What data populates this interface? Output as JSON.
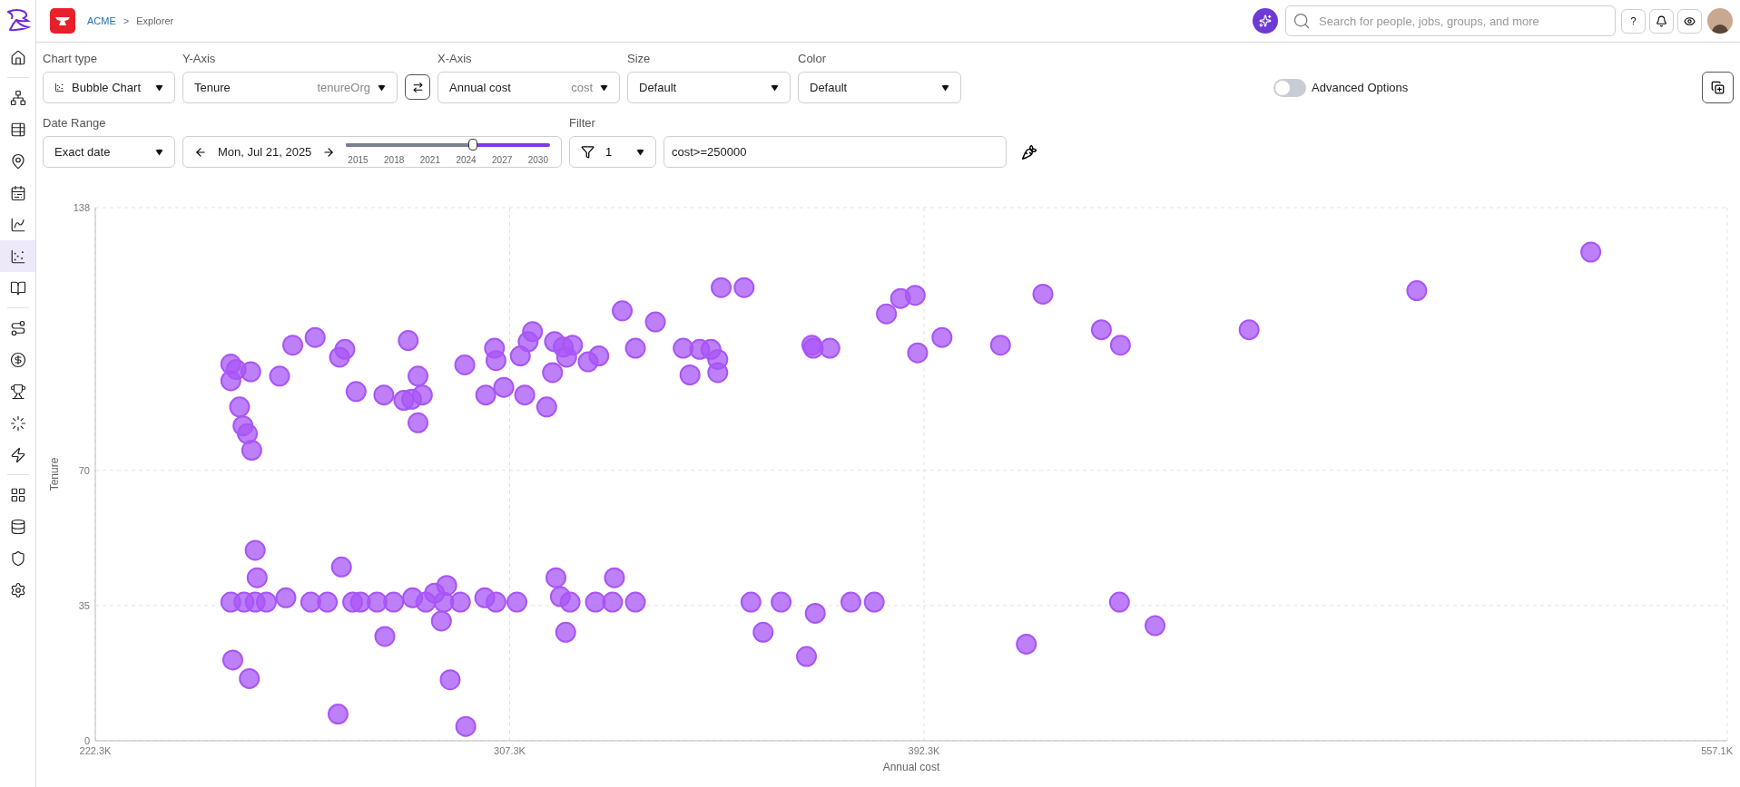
{
  "breadcrumb": [
    {
      "label": "ACME",
      "kind": "link"
    },
    {
      "label": ">",
      "kind": "separator"
    },
    {
      "label": "Explorer",
      "kind": "current"
    }
  ],
  "search": {
    "placeholder": "Search for people, jobs, groups, and more"
  },
  "help_button": "?",
  "sidebar": {
    "items": [
      {
        "selected": false
      },
      {
        "selected": false
      },
      {
        "selected": false
      },
      {
        "selected": false
      },
      {
        "selected": false
      },
      {
        "selected": false
      },
      {
        "selected": true
      },
      {
        "selected": false
      },
      {
        "selected": false
      },
      {
        "selected": false
      },
      {
        "selected": false
      },
      {
        "selected": false
      },
      {
        "selected": false
      },
      {
        "selected": false
      },
      {
        "selected": false
      },
      {
        "selected": false
      },
      {
        "selected": false
      }
    ]
  },
  "controls": {
    "chart_type": {
      "label": "Chart type",
      "value": "Bubble Chart"
    },
    "y_axis": {
      "label": "Y-Axis",
      "value": "Tenure",
      "hint": "tenureOrg"
    },
    "x_axis": {
      "label": "X-Axis",
      "value": "Annual cost",
      "hint": "cost"
    },
    "size": {
      "label": "Size",
      "value": "Default"
    },
    "color": {
      "label": "Color",
      "value": "Default"
    },
    "advanced_options": {
      "label": "Advanced Options",
      "on": false
    },
    "date_range": {
      "label": "Date Range",
      "value": "Exact date"
    },
    "date": {
      "value": "Mon, Jul 21, 2025",
      "level": 0.62,
      "ticks": [
        "2015",
        "2018",
        "2021",
        "2024",
        "2027",
        "2030"
      ]
    },
    "filter": {
      "label": "Filter",
      "count": "1",
      "expression": "cost>=250000"
    }
  },
  "chart": {
    "chart_data": {
      "type": "scatter",
      "grid": true,
      "xlabel": "Annual cost",
      "ylabel": "Tenure",
      "xlim": [
        222.3,
        557.1
      ],
      "ylim": [
        0,
        138
      ],
      "xticks": [
        {
          "value": 222.3,
          "label": "222.3K"
        },
        {
          "value": 307.3,
          "label": "307.3K"
        },
        {
          "value": 392.3,
          "label": "392.3K"
        },
        {
          "value": 557.1,
          "label": "557.1K"
        }
      ],
      "yticks": [
        0,
        35,
        70,
        138
      ],
      "x": [
        250.1,
        251.2,
        254.2,
        250.1,
        260.1,
        262.8,
        267.4,
        273.5,
        272.4,
        275.8,
        281.5,
        286.5,
        288.5,
        285.6,
        287.2,
        289.4,
        288.5,
        251.9,
        252.6,
        253.5,
        254.4,
        298.1,
        304.2,
        304.5,
        302.4,
        306.1,
        310.4,
        309.5,
        312.0,
        311.1,
        316.5,
        318.3,
        320.2,
        319.0,
        316.1,
        314.9,
        323.4,
        325.6,
        330.4,
        333.1,
        337.2,
        342.9,
        344.3,
        346.3,
        348.6,
        350.0,
        350.0,
        350.7,
        355.4,
        369.3,
        369.6,
        373.0,
        384.6,
        387.5,
        390.5,
        391.0,
        396.0,
        408.0,
        416.7,
        428.7,
        432.6,
        459.0,
        493.4,
        529.1,
        250.1,
        252.8,
        255.1,
        257.4,
        261.4,
        266.5,
        269.9,
        275.1,
        276.7,
        280.1,
        283.5,
        287.4,
        290.1,
        291.9,
        293.8,
        297.2,
        302.2,
        304.5,
        308.8,
        255.1,
        255.5,
        272.8,
        281.7,
        293.3,
        294.4,
        316.8,
        317.7,
        319.7,
        318.8,
        324.9,
        328.4,
        328.8,
        333.1,
        356.8,
        359.3,
        363.0,
        368.2,
        370.0,
        377.3,
        382.1,
        413.3,
        432.4,
        439.7,
        250.5,
        253.9,
        272.1,
        295.1,
        298.3
      ],
      "series": [
        {
          "color": "#a855f7",
          "values": [
            97.5,
            96.1,
            95.5,
            93.2,
            94.4,
            102.4,
            104.4,
            101.3,
            99.3,
            90.4,
            89.5,
            103.6,
            94.4,
            88.1,
            88.4,
            89.5,
            82.3,
            86.4,
            81.5,
            79.5,
            75.2,
            97.3,
            101.6,
            98.4,
            89.5,
            91.5,
            89.5,
            99.6,
            105.9,
            103.3,
            103.3,
            101.9,
            102.4,
            99.3,
            95.3,
            86.4,
            98.1,
            99.6,
            111.3,
            101.6,
            108.4,
            101.6,
            94.7,
            101.3,
            101.3,
            98.7,
            95.3,
            117.3,
            117.3,
            102.4,
            101.6,
            101.6,
            110.5,
            114.5,
            115.3,
            100.4,
            104.4,
            102.4,
            115.6,
            106.4,
            102.4,
            106.4,
            116.5,
            126.5,
            35.9,
            35.9,
            35.9,
            35.9,
            37.0,
            35.9,
            35.9,
            35.9,
            35.9,
            35.9,
            35.9,
            37.0,
            35.9,
            38.2,
            35.9,
            35.9,
            37.0,
            35.9,
            35.9,
            49.3,
            42.2,
            45.0,
            27.0,
            31.0,
            40.2,
            42.2,
            37.3,
            35.9,
            28.1,
            35.9,
            35.9,
            42.2,
            35.9,
            35.9,
            28.1,
            35.9,
            21.8,
            33.0,
            35.9,
            35.9,
            25.0,
            35.9,
            29.8,
            20.9,
            16.1,
            6.9,
            15.8,
            3.7
          ]
        }
      ]
    }
  }
}
